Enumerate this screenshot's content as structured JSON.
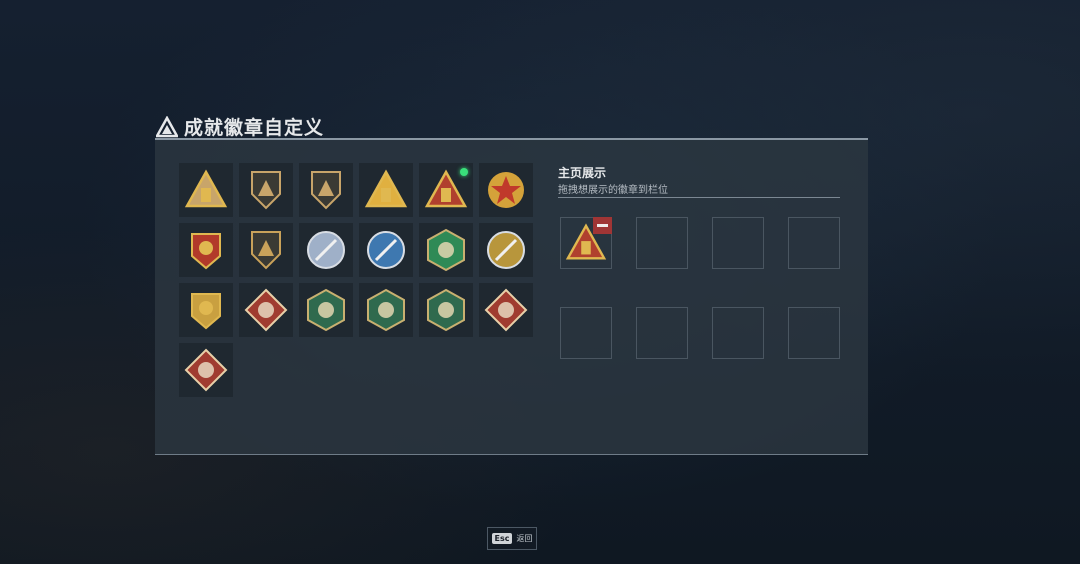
{
  "page": {
    "title": "成就徽章自定义",
    "title_icon": "triangle-emblem-icon"
  },
  "badges": [
    {
      "name": "triangle-emblem-badge",
      "color": "#c8a56a"
    },
    {
      "name": "helicopter-badge",
      "color": "#c8a56a"
    },
    {
      "name": "wings-dagger-badge",
      "color": "#c8a56a"
    },
    {
      "name": "gold-triangle-medal-badge",
      "color": "#e0b040"
    },
    {
      "name": "red-triangle-badge",
      "color": "#b0402e",
      "new": true
    },
    {
      "name": "red-star-gear-badge",
      "color": "#c0392b"
    },
    {
      "name": "red-laurel-badge",
      "color": "#b23a2a"
    },
    {
      "name": "gold-shield-badge",
      "color": "#c9a25a"
    },
    {
      "name": "flower-badge",
      "color": "#9fb0c8"
    },
    {
      "name": "blue-sword-badge",
      "color": "#3e78b0"
    },
    {
      "name": "green-sword-badge",
      "color": "#2f8a56"
    },
    {
      "name": "gold-sword-badge",
      "color": "#b8963c"
    },
    {
      "name": "gold-crossed-swords-badge",
      "color": "#c9a040"
    },
    {
      "name": "wolf-diamond-badge",
      "color": "#a03c30"
    },
    {
      "name": "green-bird-badge",
      "color": "#2f6a4e"
    },
    {
      "name": "green-gun-badge",
      "color": "#2f6a4e"
    },
    {
      "name": "green-figure-badge",
      "color": "#2f6a4e"
    },
    {
      "name": "dragon-diamond-badge",
      "color": "#a03c30"
    },
    {
      "name": "runner-diamond-badge",
      "color": "#a03c30"
    }
  ],
  "showcase": {
    "title": "主页展示",
    "subtitle": "拖拽想展示的徽章到栏位",
    "slots": [
      {
        "badge": "red-triangle-badge"
      },
      {
        "badge": null
      },
      {
        "badge": null
      },
      {
        "badge": null
      },
      {
        "badge": null
      },
      {
        "badge": null
      },
      {
        "badge": null
      },
      {
        "badge": null
      }
    ]
  },
  "footer": {
    "key": "Esc",
    "label": "返回"
  },
  "colors": {
    "accent_new": "#39e07a",
    "remove": "#a03535"
  }
}
